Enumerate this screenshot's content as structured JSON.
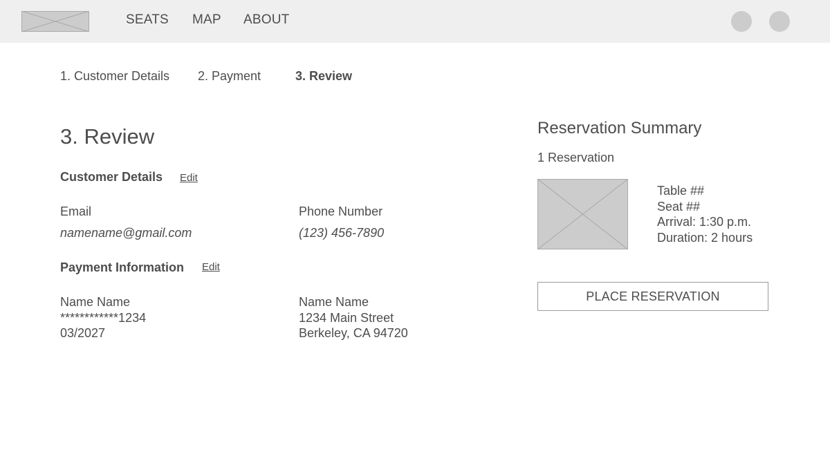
{
  "nav": {
    "items": [
      {
        "label": "SEATS"
      },
      {
        "label": "MAP"
      },
      {
        "label": "ABOUT"
      }
    ]
  },
  "steps": [
    {
      "label": "1. Customer Details",
      "active": false
    },
    {
      "label": "2. Payment",
      "active": false
    },
    {
      "label": "3. Review",
      "active": true
    }
  ],
  "review": {
    "title": "3. Review",
    "customer": {
      "section_title": "Customer Details",
      "edit_label": "Edit",
      "email_label": "Email",
      "email_value": "namename@gmail.com",
      "phone_label": "Phone Number",
      "phone_value": "(123) 456-7890"
    },
    "payment": {
      "section_title": "Payment Information",
      "edit_label": "Edit",
      "card": [
        "Name Name",
        "************1234",
        "03/2027"
      ],
      "billing": [
        "Name Name",
        "1234 Main Street",
        "Berkeley, CA 94720"
      ]
    }
  },
  "summary": {
    "title": "Reservation Summary",
    "count": "1 Reservation",
    "details": [
      "Table ##",
      "Seat ##",
      "Arrival: 1:30 p.m.",
      "Duration: 2 hours"
    ],
    "button_label": "PLACE RESERVATION"
  },
  "colors": {
    "topbar_bg": "#efefef",
    "placeholder_gray": "#cccccc",
    "text": "#4d4d4d"
  },
  "icons": {
    "logo": "image-placeholder-icon",
    "profile_1": "circle-avatar",
    "profile_2": "circle-avatar",
    "reservation_image": "image-placeholder-icon"
  }
}
